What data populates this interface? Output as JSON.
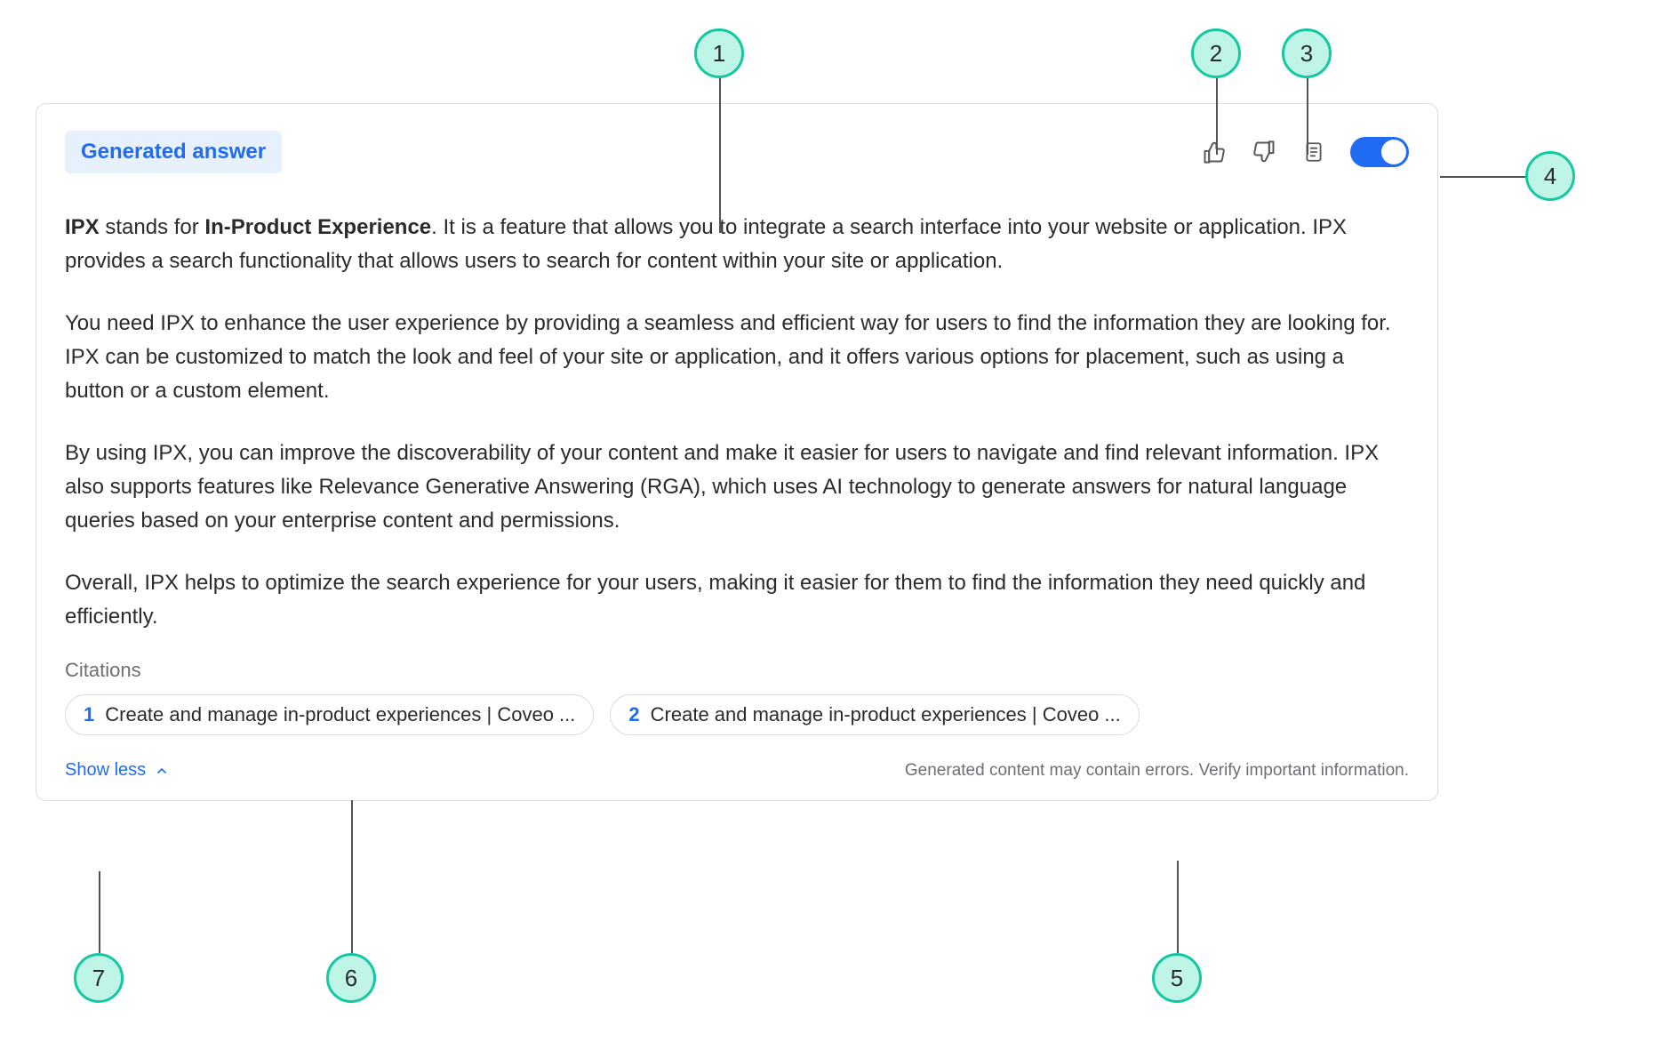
{
  "header": {
    "badge_label": "Generated answer",
    "icons": {
      "thumbs_up": "thumbs-up-icon",
      "thumbs_down": "thumbs-down-icon",
      "copy": "copy-icon"
    },
    "toggle_on": true
  },
  "answer": {
    "p1_prefix": "IPX",
    "p1_mid": " stands for ",
    "p1_bold": "In-Product Experience",
    "p1_rest": ". It is a feature that allows you to integrate a search interface into your website or application. IPX provides a search functionality that allows users to search for content within your site or application.",
    "p2": "You need IPX to enhance the user experience by providing a seamless and efficient way for users to find the information they are looking for. IPX can be customized to match the look and feel of your site or application, and it offers various options for placement, such as using a button or a custom element.",
    "p3": "By using IPX, you can improve the discoverability of your content and make it easier for users to navigate and find relevant information. IPX also supports features like Relevance Generative Answering (RGA), which uses AI technology to generate answers for natural language queries based on your enterprise content and permissions.",
    "p4": "Overall, IPX helps to optimize the search experience for your users, making it easier for them to find the information they need quickly and efficiently."
  },
  "citations": {
    "label": "Citations",
    "items": [
      {
        "num": "1",
        "title": "Create and manage in-product experiences | Coveo ..."
      },
      {
        "num": "2",
        "title": "Create and manage in-product experiences | Coveo ..."
      }
    ]
  },
  "footer": {
    "show_less": "Show less",
    "disclaimer": "Generated content may contain errors. Verify important information."
  },
  "callouts": {
    "c1": "1",
    "c2": "2",
    "c3": "3",
    "c4": "4",
    "c5": "5",
    "c6": "6",
    "c7": "7"
  }
}
